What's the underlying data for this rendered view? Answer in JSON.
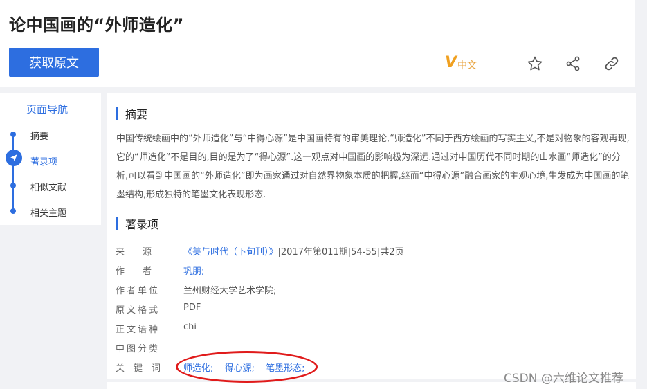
{
  "header": {
    "title": "论中国画的“外师造化”",
    "download_label": "获取原文",
    "lang_v": "V",
    "lang_zh": "中文"
  },
  "icons": {
    "favorite": "star-icon",
    "share": "share-icon",
    "link": "link-icon"
  },
  "nav": {
    "title": "页面导航",
    "items": [
      "摘要",
      "著录项",
      "相似文献",
      "相关主题"
    ],
    "active_index": 1
  },
  "abstract": {
    "heading": "摘要",
    "text": "中国传统绘画中的“外师造化”与“中得心源”是中国画特有的审美理论,“师造化”不同于西方绘画的写实主义,不是对物象的客观再现,它的“师造化”不是目的,目的是为了“得心源”.这一观点对中国画的影响极为深远.通过对中国历代不同时期的山水画“师造化”的分析,可以看到中国画的“外师造化”即为画家通过对自然界物象本质的把握,继而“中得心源”融合画家的主观心境,生发成为中国画的笔墨结构,形成独特的笔墨文化表现形态."
  },
  "record": {
    "heading": "著录项",
    "source_label": "来　　源",
    "source_link": "《美与时代（下旬刊）》",
    "source_rest": "|2017年第011期|54-55|共2页",
    "author_label": "作　　者",
    "author": "巩朋;",
    "unit_label": "作者单位",
    "unit": "兰州财经大学艺术学院;",
    "format_label": "原文格式",
    "format": "PDF",
    "lang_label": "正文语种",
    "lang": "chi",
    "class_label": "中图分类",
    "class": "",
    "kw_label": "关　键　词",
    "keywords": [
      "师造化;",
      "得心源;",
      "笔墨形态;"
    ]
  },
  "colors": {
    "accent": "#2d6ee0",
    "highlight": "#e01b1b",
    "badge": "#e8a23b"
  },
  "watermark": "CSDN @六维论文推荐"
}
